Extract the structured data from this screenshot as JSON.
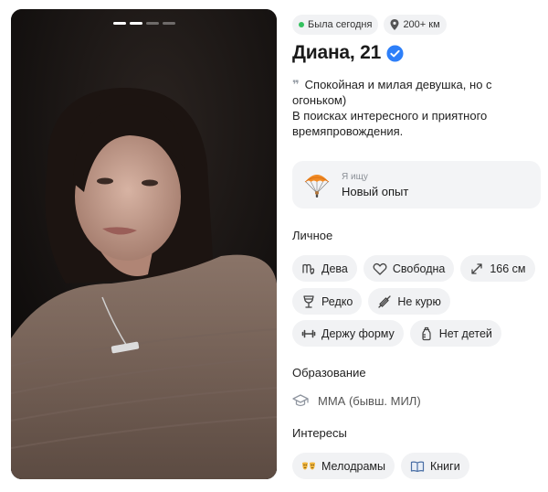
{
  "profile": {
    "status": "Была сегодня",
    "distance": "200+ км",
    "name_age": "Диана, 21",
    "bio_line1": "Спокойная и милая девушка, но с огоньком)",
    "bio_line2": "В поисках интересного и приятного времяпровождения."
  },
  "photo": {
    "page_count": 4,
    "active_index": 1
  },
  "looking_for": {
    "label": "Я ищу",
    "value": "Новый опыт"
  },
  "personal": {
    "title": "Личное",
    "tags": [
      {
        "icon": "virgo-icon",
        "label": "Дева"
      },
      {
        "icon": "heart-icon",
        "label": "Свободна"
      },
      {
        "icon": "height-arrows-icon",
        "label": "166 см"
      },
      {
        "icon": "wine-glass-icon",
        "label": "Редко"
      },
      {
        "icon": "no-smoking-icon",
        "label": "Не курю"
      },
      {
        "icon": "dumbbell-icon",
        "label": "Держу форму"
      },
      {
        "icon": "baby-bottle-icon",
        "label": "Нет детей"
      }
    ]
  },
  "education": {
    "title": "Образование",
    "value": "ММА (бывш. МИЛ)"
  },
  "interests": {
    "title": "Интересы",
    "tags": [
      {
        "icon": "drama-masks-icon",
        "label": "Мелодрамы"
      },
      {
        "icon": "book-icon",
        "label": "Книги"
      }
    ]
  },
  "colors": {
    "online": "#35c15f",
    "verified": "#2d7ff9",
    "chip_bg": "#f1f2f4"
  }
}
